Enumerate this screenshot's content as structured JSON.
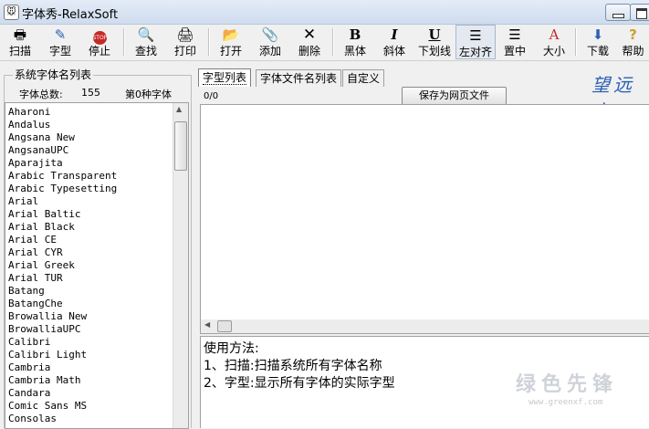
{
  "window": {
    "title": "字体秀-RelaxSoft",
    "app_icon_glyph": "🐭"
  },
  "toolbar": {
    "buttons": [
      {
        "label": "扫描",
        "icon": "printer-scan-icon"
      },
      {
        "label": "字型",
        "icon": "font-wand-icon"
      },
      {
        "label": "停止",
        "icon": "stop-sign-icon",
        "icon_text": "STOP"
      },
      {
        "label": "查找",
        "icon": "search-document-icon"
      },
      {
        "label": "打印",
        "icon": "printer-icon"
      },
      {
        "label": "打开",
        "icon": "open-folder-icon"
      },
      {
        "label": "添加",
        "icon": "paperclip-icon"
      },
      {
        "label": "删除",
        "icon": "delete-x-icon"
      },
      {
        "label": "黑体",
        "icon": "bold-icon",
        "icon_text": "B"
      },
      {
        "label": "斜体",
        "icon": "italic-icon",
        "icon_text": "I"
      },
      {
        "label": "下划线",
        "icon": "underline-icon",
        "icon_text": "U"
      },
      {
        "label": "左对齐",
        "icon": "align-left-icon"
      },
      {
        "label": "置中",
        "icon": "align-center-icon"
      },
      {
        "label": "大小",
        "icon": "font-size-icon",
        "icon_text": "A"
      },
      {
        "label": "下载",
        "icon": "download-icon"
      },
      {
        "label": "帮助",
        "icon": "help-icon",
        "icon_text": "?"
      }
    ],
    "pressed": "左对齐"
  },
  "left_panel": {
    "group_title": "系统字体名列表",
    "count_label": "字体总数:",
    "count_value": "155",
    "index_label": "第0种字体",
    "fonts": [
      "Aharoni",
      "Andalus",
      "Angsana New",
      "AngsanaUPC",
      "Aparajita",
      "Arabic Transparent",
      "Arabic Typesetting",
      "Arial",
      "Arial Baltic",
      "Arial Black",
      "Arial CE",
      "Arial CYR",
      "Arial Greek",
      "Arial TUR",
      "Batang",
      "BatangChe",
      "Browallia New",
      "BrowalliaUPC",
      "Calibri",
      "Calibri Light",
      "Cambria",
      "Cambria Math",
      "Candara",
      "Comic Sans MS",
      "Consolas"
    ]
  },
  "tabs": [
    {
      "label": "字型列表",
      "active": true
    },
    {
      "label": "字体文件名列表",
      "active": false
    },
    {
      "label": "自定义",
      "active": false
    }
  ],
  "preview": {
    "save_button": "保存为网页文件",
    "counter": "0/0"
  },
  "usage": {
    "lines": [
      "使用方法:",
      "1、扫描:扫描系统所有字体名称",
      "2、字型:显示所有字体的实际字型"
    ]
  },
  "branding": {
    "logo_text": "望远字",
    "watermark_main": "绿色先锋",
    "watermark_sub": "www.greenxf.com"
  },
  "colors": {
    "accent_blue": "#2b5fb3",
    "stop_red": "#c62828"
  }
}
